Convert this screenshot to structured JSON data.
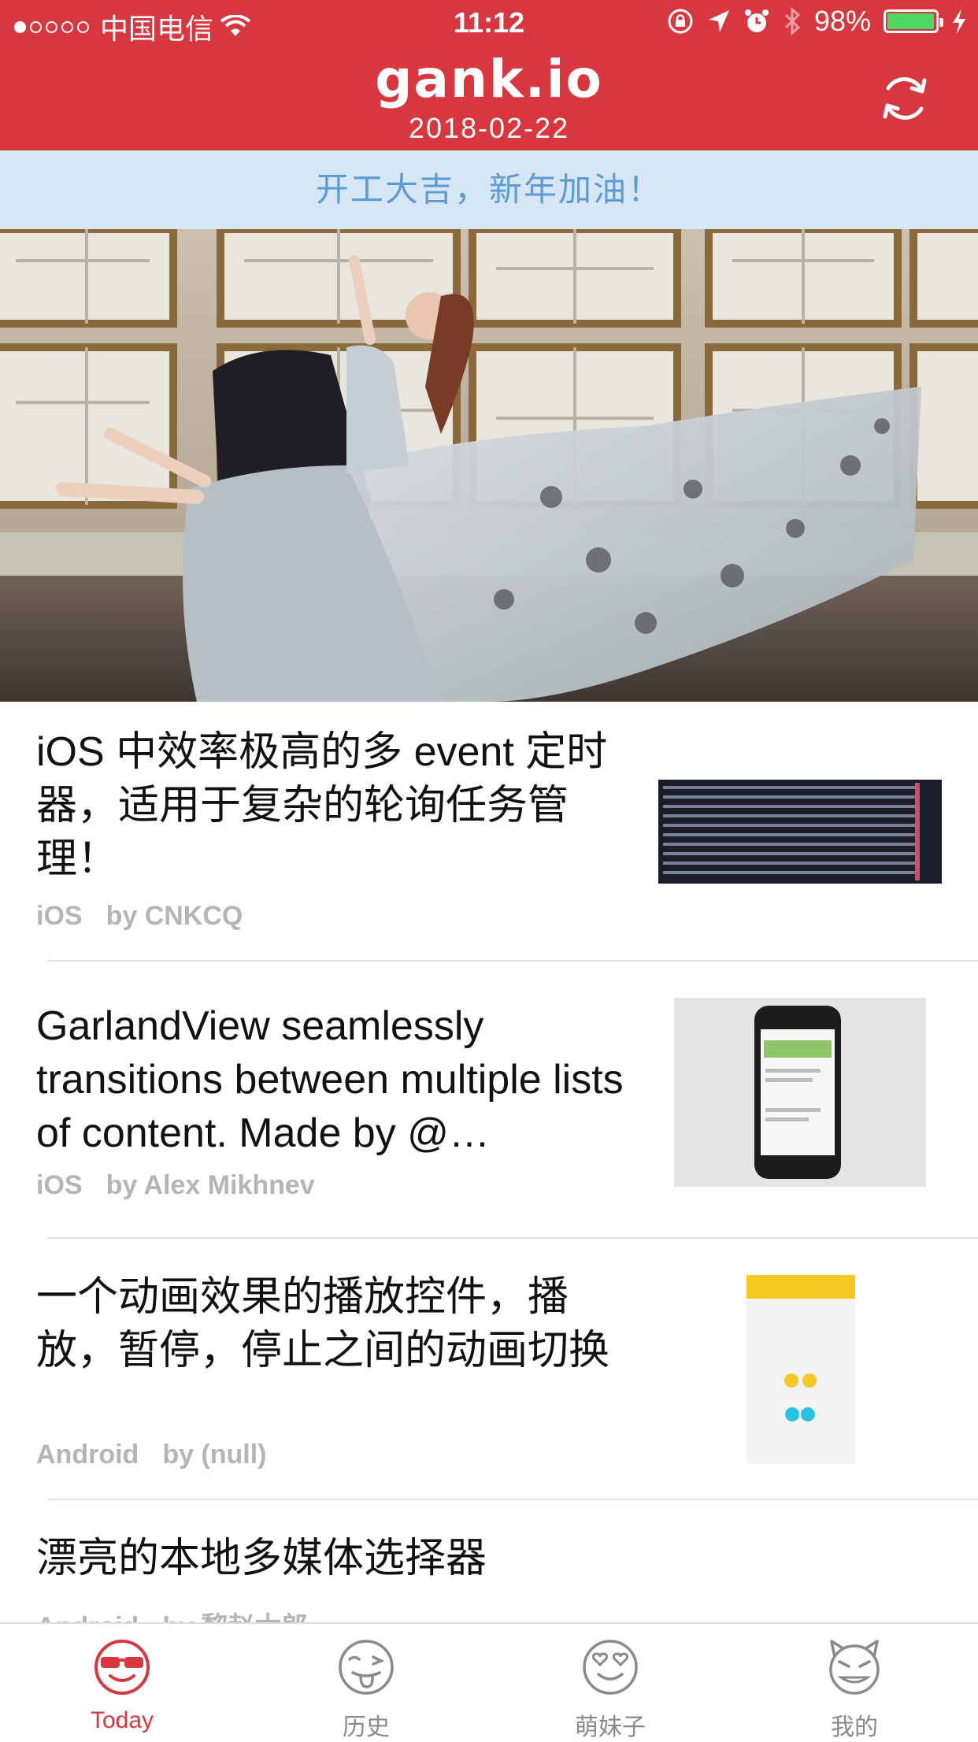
{
  "status_bar": {
    "carrier": "中国电信",
    "time": "11:12",
    "battery": "98%",
    "battery_level": 0.98,
    "signal_bars_filled": 1,
    "signal_bars_total": 5
  },
  "header": {
    "logo": "gank.io",
    "date": "2018-02-22",
    "refresh_icon": "refresh-icon"
  },
  "banner": {
    "text": "开工大吉，新年加油！"
  },
  "articles": [
    {
      "title": "iOS 中效率极高的多 event 定时器，适用于复杂的轮询任务管理！",
      "category": "iOS",
      "author": "by CNKCQ"
    },
    {
      "title": "GarlandView seamlessly transitions between multiple lists of content. Made by @…",
      "category": "iOS",
      "author": "by Alex Mikhnev"
    },
    {
      "title": "一个动画效果的播放控件，播放，暂停，停止之间的动画切换",
      "category": "Android",
      "author": "by (null)"
    },
    {
      "title": "漂亮的本地多媒体选择器",
      "category": "Android",
      "author": "by 黎赵太郎"
    }
  ],
  "tabs": [
    {
      "label": "Today",
      "icon": "sunglasses-face-icon",
      "active": true
    },
    {
      "label": "历史",
      "icon": "tongue-face-icon",
      "active": false
    },
    {
      "label": "萌妹子",
      "icon": "heart-eyes-face-icon",
      "active": false
    },
    {
      "label": "我的",
      "icon": "devil-face-icon",
      "active": false
    }
  ],
  "colors": {
    "brand_red": "#d9373f",
    "banner_bg": "#d6e6f4",
    "banner_text": "#5d9bd5",
    "meta_gray": "#b5b5b5"
  }
}
